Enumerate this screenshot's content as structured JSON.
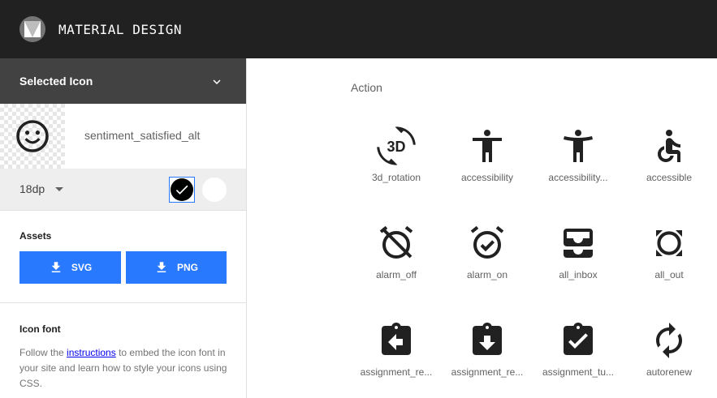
{
  "header": {
    "title": "MATERIAL DESIGN"
  },
  "sidebar": {
    "selected_label": "Selected Icon",
    "icon_name": "sentiment_satisfied_alt",
    "size": "18dp",
    "assets_title": "Assets",
    "svg_label": "SVG",
    "png_label": "PNG",
    "iconfont_title": "Icon font",
    "iconfont_text_before": "Follow the ",
    "iconfont_link": "instructions",
    "iconfont_text_after": " to embed the icon font in your site and learn how to style your icons using CSS."
  },
  "main": {
    "category": "Action",
    "icons": [
      {
        "label": "3d_rotation",
        "icon": "3d-rotation-icon"
      },
      {
        "label": "accessibility",
        "icon": "accessibility-icon"
      },
      {
        "label": "accessibility...",
        "icon": "accessibility-new-icon"
      },
      {
        "label": "accessible",
        "icon": "accessible-icon"
      },
      {
        "label": "alarm_off",
        "icon": "alarm-off-icon"
      },
      {
        "label": "alarm_on",
        "icon": "alarm-on-icon"
      },
      {
        "label": "all_inbox",
        "icon": "all-inbox-icon"
      },
      {
        "label": "all_out",
        "icon": "all-out-icon"
      },
      {
        "label": "assignment_re...",
        "icon": "assignment-return-icon"
      },
      {
        "label": "assignment_re...",
        "icon": "assignment-returned-icon"
      },
      {
        "label": "assignment_tu...",
        "icon": "assignment-turned-in-icon"
      },
      {
        "label": "autorenew",
        "icon": "autorenew-icon"
      }
    ]
  },
  "colors": {
    "topbar": "#212121",
    "accent": "#2979ff",
    "sidebar_header": "#424242"
  }
}
